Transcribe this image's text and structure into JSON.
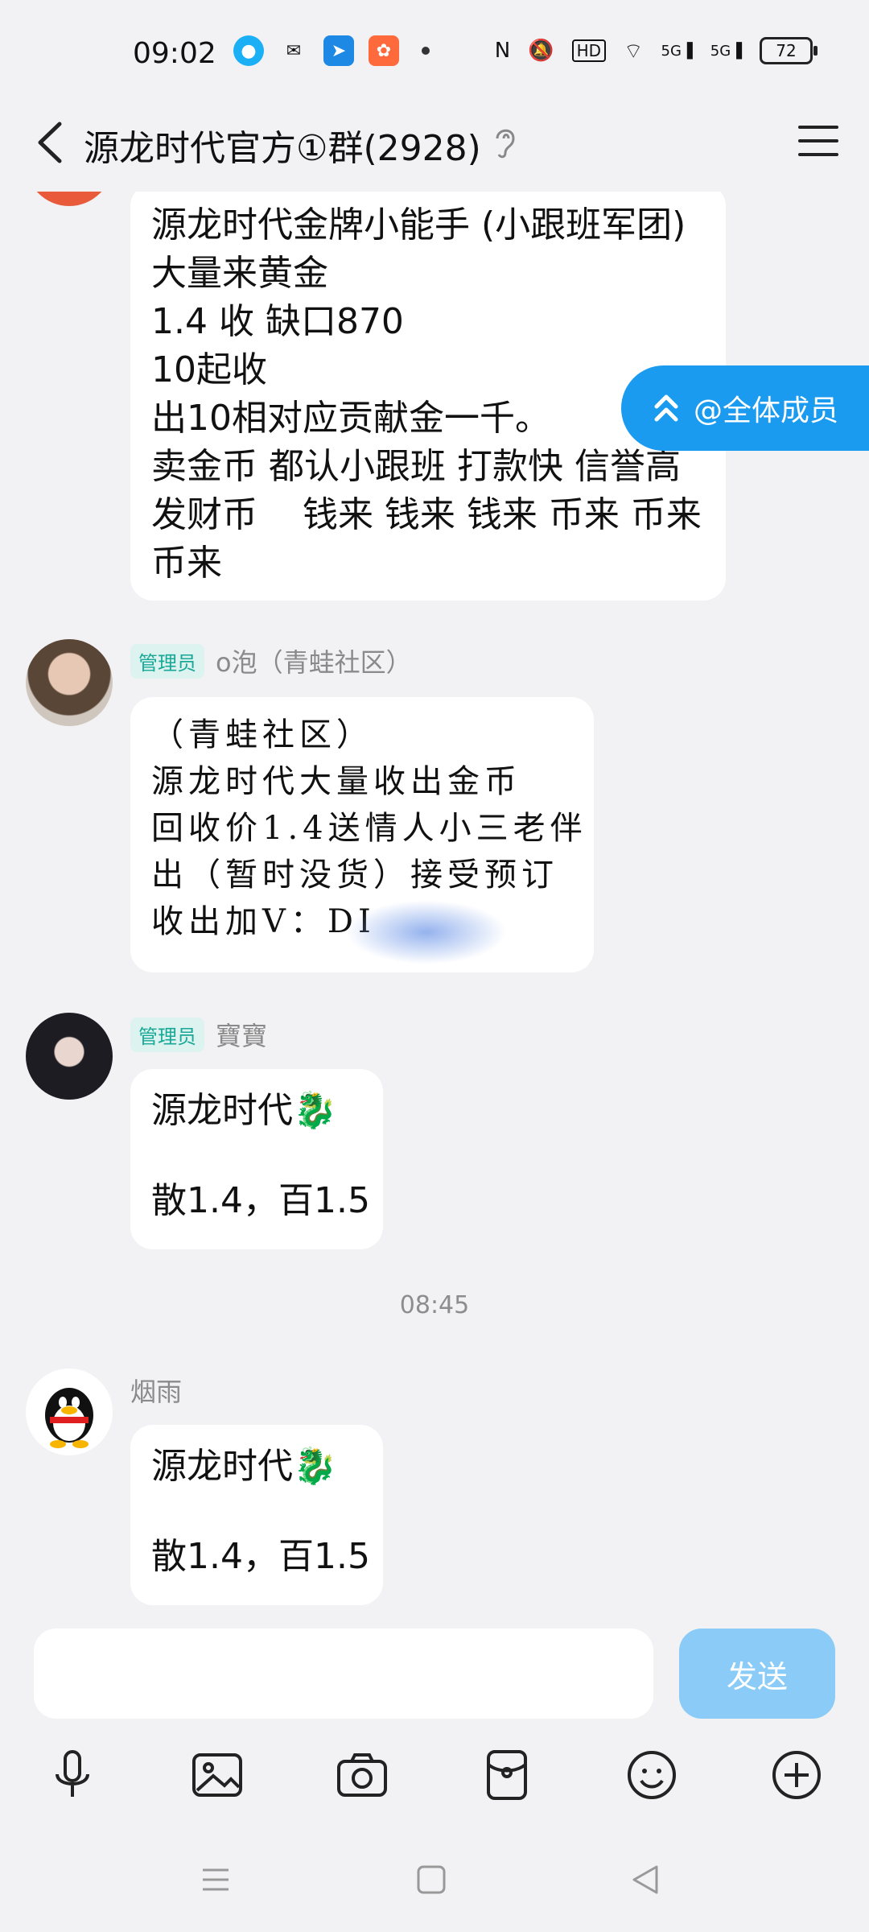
{
  "status_bar": {
    "time": "09:02",
    "battery": "72",
    "net_label_1": "5G",
    "net_label_2": "5G",
    "hd": "HD"
  },
  "header": {
    "title": "源龙时代官方①群(2928)"
  },
  "mention_button": {
    "label": "@全体成员"
  },
  "messages": [
    {
      "lines": [
        "源龙时代金牌小能手 (小跟班军团)",
        "大量来黄金",
        "1.4 收 缺口870",
        "10起收",
        "出10相对应贡献金一千。",
        "卖金币 都认小跟班 打款快 信誉高",
        "发财币    钱来 钱来 钱来 币来 币来",
        "币来"
      ]
    },
    {
      "badge": "管理员",
      "sender": "o泡（青蛙社区）",
      "lines": [
        "（青蛙社区）",
        "源龙时代大量收出金币",
        "回收价1.4送情人小三老伴",
        "出（暂时没货）接受预订",
        "收出加V：DI"
      ]
    },
    {
      "badge": "管理员",
      "sender": "寶寶",
      "lines": [
        "源龙时代🐉",
        "",
        "散1.4，百1.5"
      ]
    },
    {
      "timestamp": "08:45"
    },
    {
      "sender": "烟雨",
      "lines": [
        "源龙时代🐉",
        "",
        "散1.4，百1.5"
      ]
    }
  ],
  "input_bar": {
    "placeholder": "",
    "send_label": "发送"
  },
  "icons": {
    "tools": [
      "microphone-icon",
      "image-icon",
      "camera-icon",
      "red-packet-icon",
      "emoji-icon",
      "plus-icon"
    ],
    "nav": [
      "menu-nav-icon",
      "home-nav-icon",
      "back-nav-icon"
    ]
  }
}
